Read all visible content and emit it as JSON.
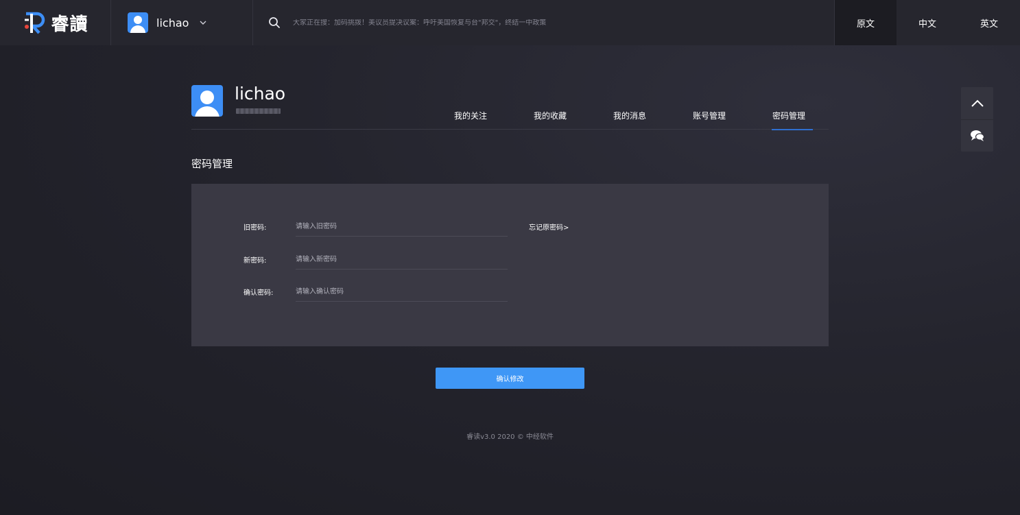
{
  "brand": {
    "logo_text": "睿讀",
    "accent_color": "#3d8ef5",
    "logo_dot_color": "#e8453c"
  },
  "header": {
    "username": "lichao",
    "search_placeholder": "大家正在搜：加码挑拨！美议员提决议案：呼吁美国恢复与台\"邦交\"，终结一中政策",
    "languages": [
      {
        "label": "原文",
        "active": true
      },
      {
        "label": "中文",
        "active": false
      },
      {
        "label": "英文",
        "active": false
      }
    ]
  },
  "profile": {
    "name": "lichao",
    "tabs": [
      {
        "label": "我的关注",
        "active": false
      },
      {
        "label": "我的收藏",
        "active": false
      },
      {
        "label": "我的消息",
        "active": false
      },
      {
        "label": "账号管理",
        "active": false
      },
      {
        "label": "密码管理",
        "active": true
      }
    ]
  },
  "section": {
    "title": "密码管理"
  },
  "form": {
    "old_label": "旧密码:",
    "old_placeholder": "请输入旧密码",
    "new_label": "新密码:",
    "new_placeholder": "请输入新密码",
    "confirm_label": "确认密码:",
    "confirm_placeholder": "请输入确认密码",
    "forgot_link": "忘记原密码>",
    "submit_label": "确认修改"
  },
  "footer": {
    "text": "睿读v3.0 2020 © 中经软件"
  },
  "side_buttons": [
    {
      "icon": "chevron-up-icon"
    },
    {
      "icon": "chat-bubbles-icon"
    }
  ]
}
